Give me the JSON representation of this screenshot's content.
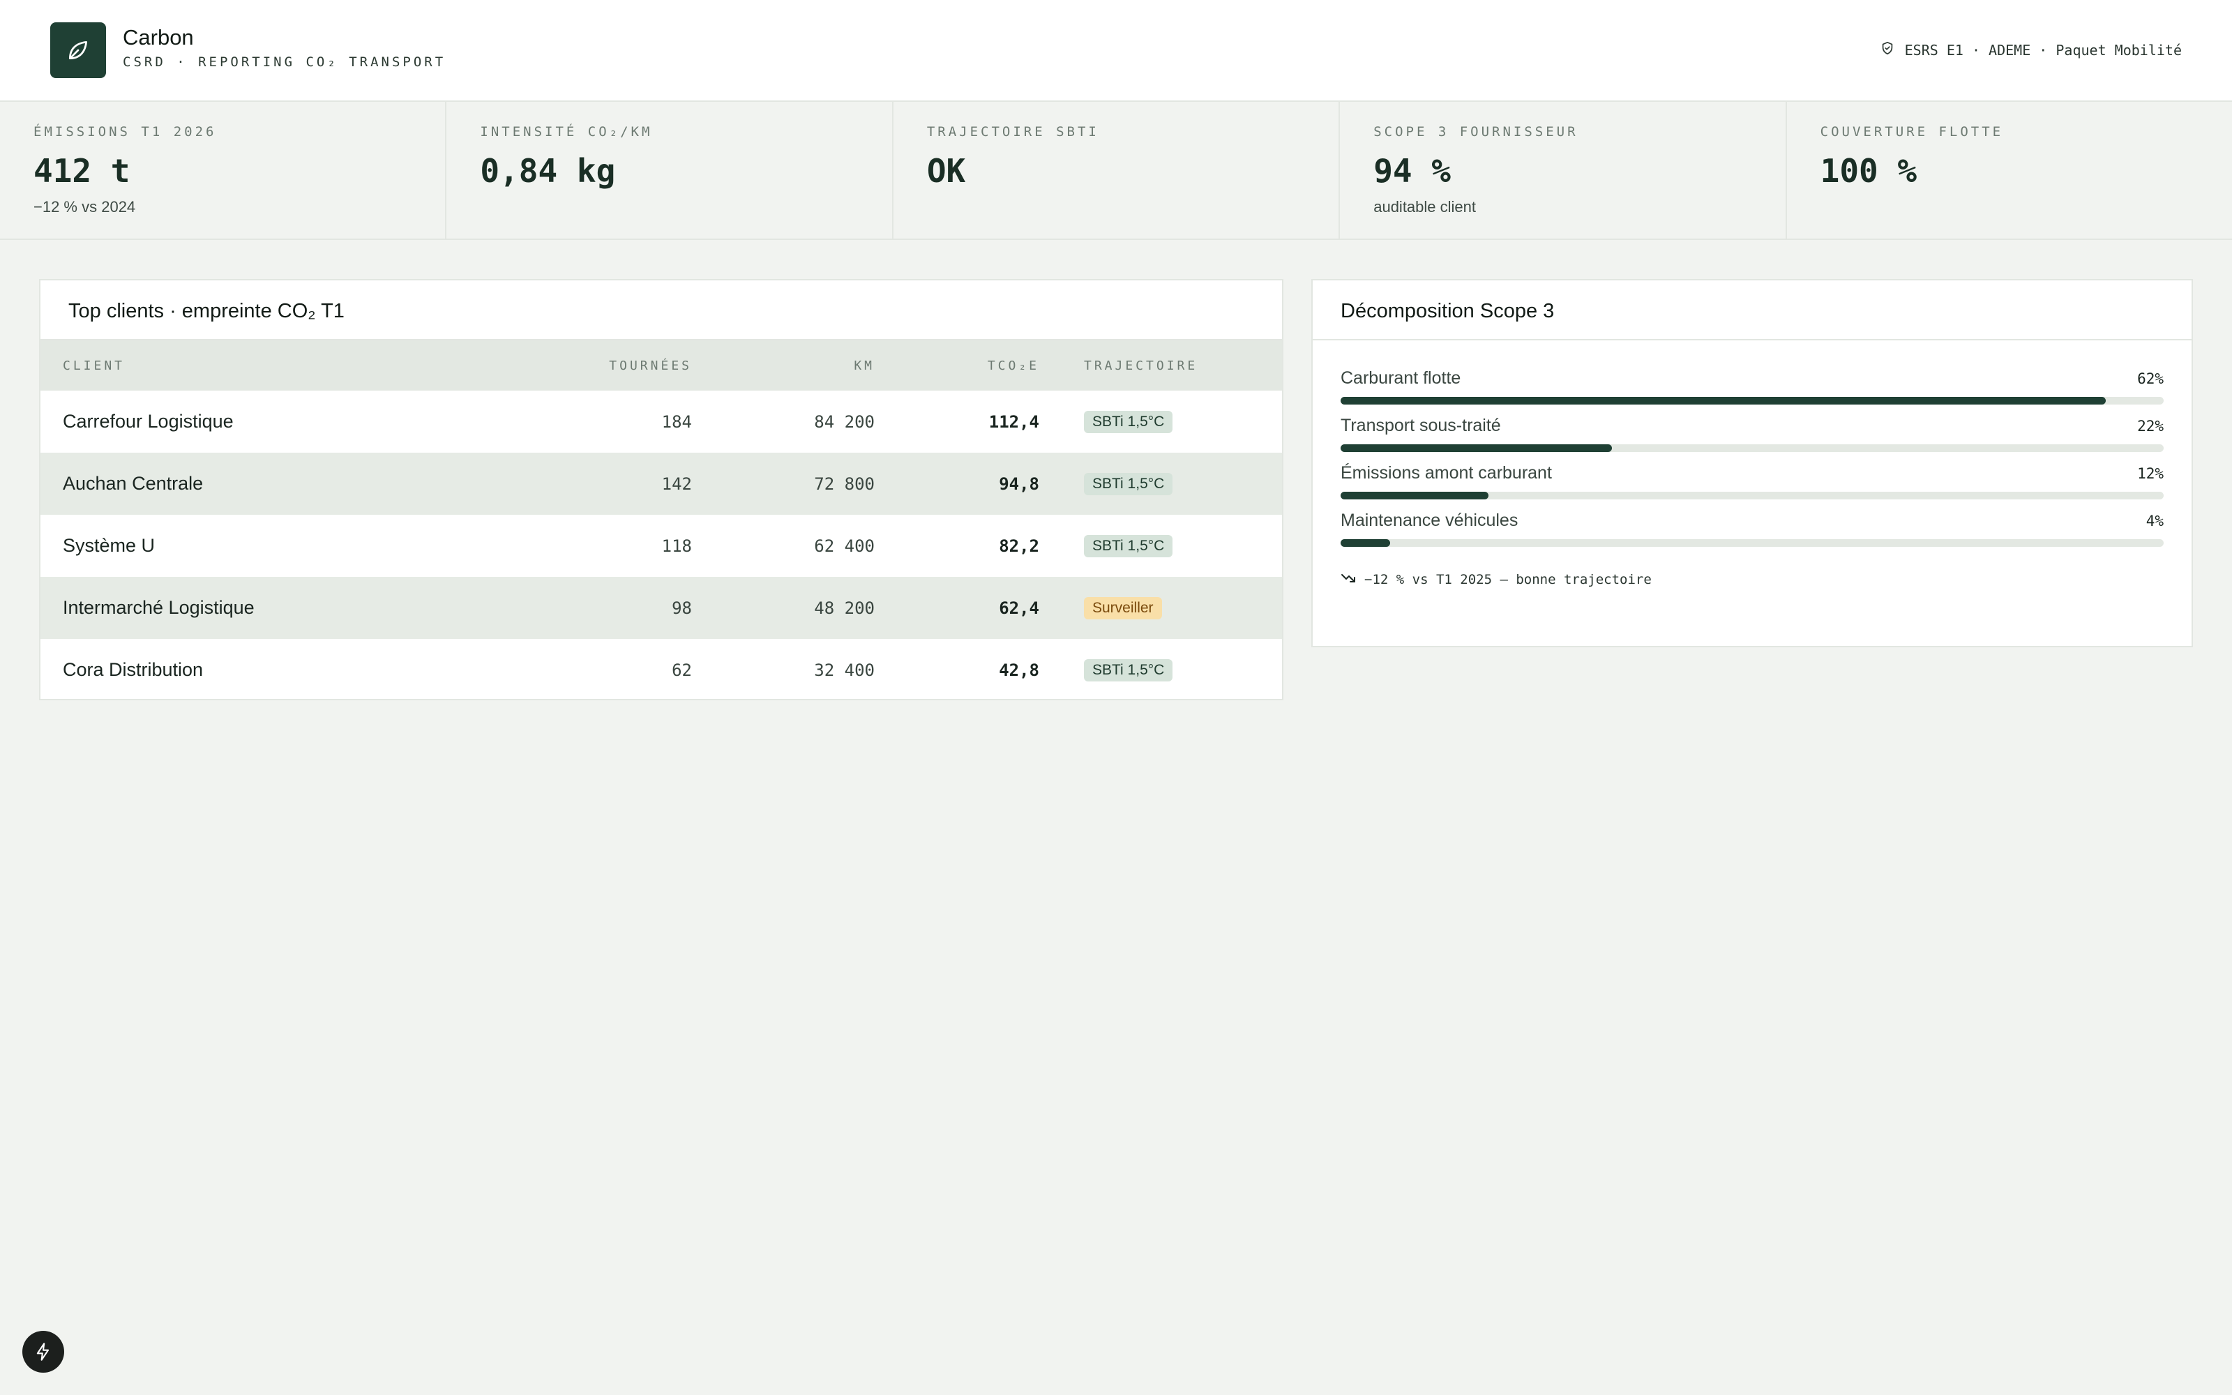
{
  "header": {
    "title": "Carbon",
    "subtitle": "CSRD · REPORTING CO₂ TRANSPORT",
    "compliance": "ESRS E1 · ADEME · Paquet Mobilité"
  },
  "kpis": [
    {
      "label": "ÉMISSIONS T1 2026",
      "value": "412 t",
      "note": "−12 % vs 2024"
    },
    {
      "label": "INTENSITÉ CO₂/KM",
      "value": "0,84 kg",
      "note": ""
    },
    {
      "label": "TRAJECTOIRE SBTI",
      "value": "OK",
      "note": ""
    },
    {
      "label": "SCOPE 3 FOURNISSEUR",
      "value": "94 %",
      "note": "auditable client"
    },
    {
      "label": "COUVERTURE FLOTTE",
      "value": "100 %",
      "note": ""
    }
  ],
  "clients": {
    "title": "Top clients · empreinte CO₂ T1",
    "columns": {
      "client": "CLIENT",
      "tournees": "TOURNÉES",
      "km": "KM",
      "tco2e": "TCO₂E",
      "trajectoire": "TRAJECTOIRE"
    },
    "rows": [
      {
        "client": "Carrefour Logistique",
        "tournees": "184",
        "km": "84 200",
        "tco2e": "112,4",
        "trajectoire": "SBTi 1,5°C",
        "warn": false
      },
      {
        "client": "Auchan Centrale",
        "tournees": "142",
        "km": "72 800",
        "tco2e": "94,8",
        "trajectoire": "SBTi 1,5°C",
        "warn": false
      },
      {
        "client": "Système U",
        "tournees": "118",
        "km": "62 400",
        "tco2e": "82,2",
        "trajectoire": "SBTi 1,5°C",
        "warn": false
      },
      {
        "client": "Intermarché Logistique",
        "tournees": "98",
        "km": "48 200",
        "tco2e": "62,4",
        "trajectoire": "Surveiller",
        "warn": true
      },
      {
        "client": "Cora Distribution",
        "tournees": "62",
        "km": "32 400",
        "tco2e": "42,8",
        "trajectoire": "SBTi 1,5°C",
        "warn": false
      }
    ]
  },
  "scope3": {
    "title": "Décomposition Scope 3",
    "items": [
      {
        "label": "Carburant flotte",
        "pct_label": "62%",
        "fraction": 0.62
      },
      {
        "label": "Transport sous-traité",
        "pct_label": "22%",
        "fraction": 0.22
      },
      {
        "label": "Émissions amont carburant",
        "pct_label": "12%",
        "fraction": 0.12
      },
      {
        "label": "Maintenance véhicules",
        "pct_label": "4%",
        "fraction": 0.04
      }
    ],
    "note": "−12 % vs T1 2025 — bonne trajectoire"
  },
  "colors": {
    "brand": "#1f4034",
    "warn": "#f9dfa8",
    "badge": "#d6e3da"
  },
  "icons": {
    "logo": "leaf-icon",
    "compliance": "shield-check-icon",
    "trend": "trend-down-icon",
    "fab": "lightning-icon"
  }
}
